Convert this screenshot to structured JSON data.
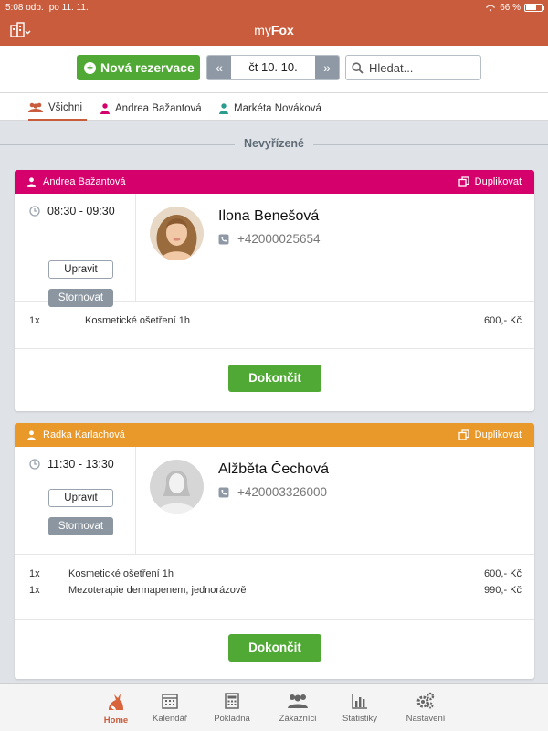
{
  "status": {
    "time": "5:08 odp.",
    "date": "po 11. 11.",
    "battery": "66 %",
    "battery_level": 0.66
  },
  "app": {
    "title_pre": "my",
    "title_bold": "Fox"
  },
  "toolbar": {
    "new_label": "Nová rezervace",
    "date_label": "čt 10. 10.",
    "search_placeholder": "Hledat..."
  },
  "tabs": [
    {
      "label": "Všichni",
      "color": "#c85c3c"
    },
    {
      "label": "Andrea Bažantová",
      "color": "#d6006d"
    },
    {
      "label": "Markéta Nováková",
      "color": "#2a9d8f"
    }
  ],
  "section_title": "Nevyřízené",
  "reservations": [
    {
      "staff": "Andrea Bažantová",
      "staff_color": "#d6006d",
      "duplicate_label": "Duplikovat",
      "time": "08:30 - 09:30",
      "edit_label": "Upravit",
      "cancel_label": "Stornovat",
      "customer": "Ilona Benešová",
      "phone": "+42000025654",
      "items": [
        {
          "qty": "1x",
          "name": "Kosmetické ošetření 1h",
          "price": "600,- Kč"
        }
      ],
      "done_label": "Dokončit"
    },
    {
      "staff": "Radka Karlachová",
      "staff_color": "#e9982a",
      "duplicate_label": "Duplikovat",
      "time": "11:30 - 13:30",
      "edit_label": "Upravit",
      "cancel_label": "Stornovat",
      "customer": "Alžběta Čechová",
      "phone": "+420003326000",
      "items": [
        {
          "qty": "1x",
          "name": "Kosmetické ošetření 1h",
          "price": "600,- Kč"
        },
        {
          "qty": "1x",
          "name": "Mezoterapie dermapenem, jednorázově",
          "price": "990,- Kč"
        }
      ],
      "done_label": "Dokončit"
    }
  ],
  "bottom_nav": [
    {
      "label": "Home",
      "icon": "fox-icon",
      "active": true
    },
    {
      "label": "Kalendář",
      "icon": "calendar-icon"
    },
    {
      "label": "Pokladna",
      "icon": "calculator-icon"
    },
    {
      "label": "Zákazníci",
      "icon": "people-icon"
    },
    {
      "label": "Statistiky",
      "icon": "bar-chart-icon"
    },
    {
      "label": "Nastavení",
      "icon": "gears-icon"
    }
  ]
}
